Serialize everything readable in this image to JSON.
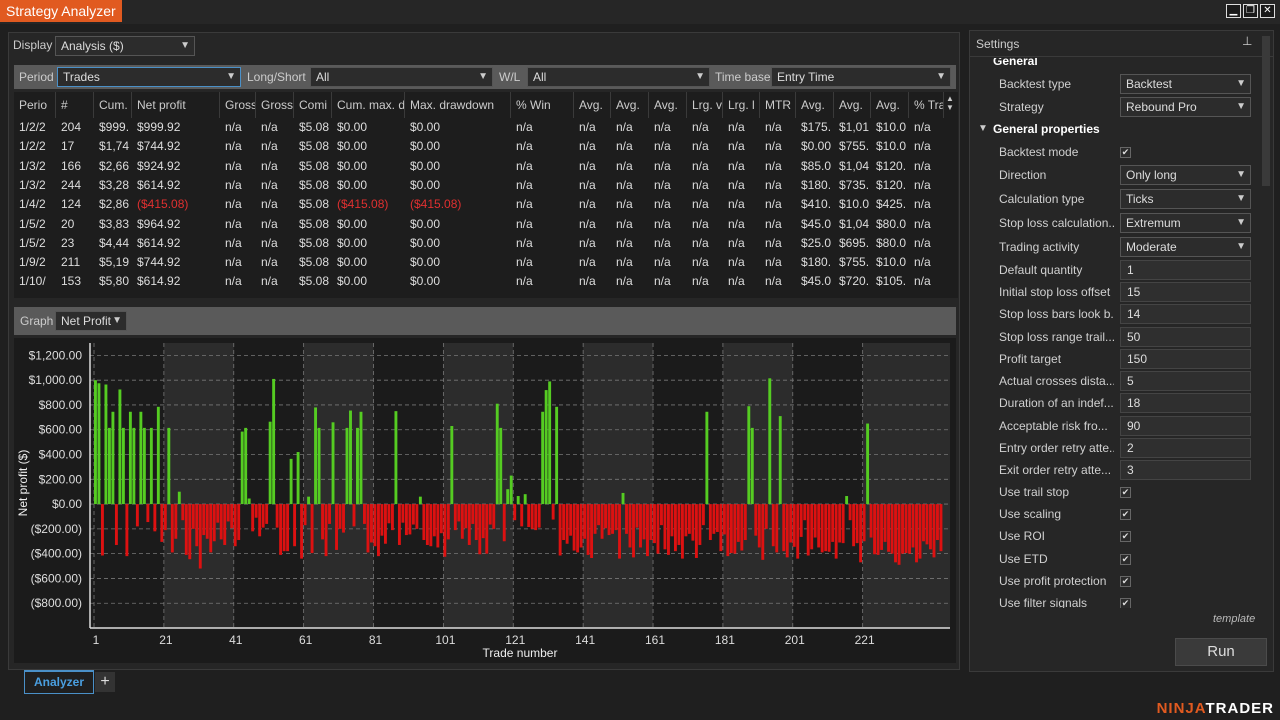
{
  "window": {
    "title": "Strategy Analyzer"
  },
  "display": {
    "label": "Display",
    "value": "Analysis ($)"
  },
  "filters": {
    "period_label": "Period",
    "period_value": "Trades",
    "longshort_label": "Long/Short",
    "longshort_value": "All",
    "wl_label": "W/L",
    "wl_value": "All",
    "timebase_label": "Time base",
    "timebase_value": "Entry Time"
  },
  "grid": {
    "columns": [
      "Perio",
      "#",
      "Cum.",
      "Net profit",
      "Gross",
      "Gross",
      "Comi",
      "Cum. max. d",
      "Max. drawdown",
      "% Win",
      "Avg.",
      "Avg.",
      "Avg.",
      "Lrg. v",
      "Lrg. l",
      "MTR",
      "Avg.",
      "Avg.",
      "Avg.",
      "% Tra"
    ],
    "rows": [
      [
        "1/2/2",
        "204",
        "$999.",
        "$999.92",
        "n/a",
        "n/a",
        "$5.08",
        "$0.00",
        "$0.00",
        "n/a",
        "n/a",
        "n/a",
        "n/a",
        "n/a",
        "n/a",
        "n/a",
        "$175.",
        "$1,01",
        "$10.0",
        "n/a"
      ],
      [
        "1/2/2",
        "17",
        "$1,74",
        "$744.92",
        "n/a",
        "n/a",
        "$5.08",
        "$0.00",
        "$0.00",
        "n/a",
        "n/a",
        "n/a",
        "n/a",
        "n/a",
        "n/a",
        "n/a",
        "$0.00",
        "$755.",
        "$10.0",
        "n/a"
      ],
      [
        "1/3/2",
        "166",
        "$2,66",
        "$924.92",
        "n/a",
        "n/a",
        "$5.08",
        "$0.00",
        "$0.00",
        "n/a",
        "n/a",
        "n/a",
        "n/a",
        "n/a",
        "n/a",
        "n/a",
        "$85.0",
        "$1,04",
        "$120.",
        "n/a"
      ],
      [
        "1/3/2",
        "244",
        "$3,28",
        "$614.92",
        "n/a",
        "n/a",
        "$5.08",
        "$0.00",
        "$0.00",
        "n/a",
        "n/a",
        "n/a",
        "n/a",
        "n/a",
        "n/a",
        "n/a",
        "$180.",
        "$735.",
        "$120.",
        "n/a"
      ],
      [
        "1/4/2",
        "124",
        "$2,86",
        "($415.08)",
        "n/a",
        "n/a",
        "$5.08",
        "($415.08)",
        "($415.08)",
        "n/a",
        "n/a",
        "n/a",
        "n/a",
        "n/a",
        "n/a",
        "n/a",
        "$410.",
        "$10.0",
        "$425.",
        "n/a"
      ],
      [
        "1/5/2",
        "20",
        "$3,83",
        "$964.92",
        "n/a",
        "n/a",
        "$5.08",
        "$0.00",
        "$0.00",
        "n/a",
        "n/a",
        "n/a",
        "n/a",
        "n/a",
        "n/a",
        "n/a",
        "$45.0",
        "$1,04",
        "$80.0",
        "n/a"
      ],
      [
        "1/5/2",
        "23",
        "$4,44",
        "$614.92",
        "n/a",
        "n/a",
        "$5.08",
        "$0.00",
        "$0.00",
        "n/a",
        "n/a",
        "n/a",
        "n/a",
        "n/a",
        "n/a",
        "n/a",
        "$25.0",
        "$695.",
        "$80.0",
        "n/a"
      ],
      [
        "1/9/2",
        "211",
        "$5,19",
        "$744.92",
        "n/a",
        "n/a",
        "$5.08",
        "$0.00",
        "$0.00",
        "n/a",
        "n/a",
        "n/a",
        "n/a",
        "n/a",
        "n/a",
        "n/a",
        "$180.",
        "$755.",
        "$10.0",
        "n/a"
      ],
      [
        "1/10/",
        "153",
        "$5,80",
        "$614.92",
        "n/a",
        "n/a",
        "$5.08",
        "$0.00",
        "$0.00",
        "n/a",
        "n/a",
        "n/a",
        "n/a",
        "n/a",
        "n/a",
        "n/a",
        "$45.0",
        "$720.",
        "$105.",
        "n/a"
      ]
    ]
  },
  "graph": {
    "label": "Graph",
    "value": "Net Profit"
  },
  "colors": {
    "accent": "#e15a20",
    "positive": "#55cc22",
    "negative": "#dd1111",
    "tab": "#4a9fe0"
  },
  "chart_data": {
    "type": "bar",
    "xlabel": "Trade number",
    "ylabel": "Net profit ($)",
    "ylim": [
      -1000,
      1300
    ],
    "yticks": [
      "$1,200.00",
      "$1,000.00",
      "$800.00",
      "$600.00",
      "$400.00",
      "$200.00",
      "$0.00",
      "($200.00)",
      "($400.00)",
      "($600.00)",
      "($800.00)"
    ],
    "ytick_values": [
      1200,
      1000,
      800,
      600,
      400,
      200,
      0,
      -200,
      -400,
      -600,
      -800
    ],
    "xticks": [
      "1",
      "21",
      "41",
      "61",
      "81",
      "101",
      "121",
      "141",
      "161",
      "181",
      "201",
      "221"
    ],
    "xtick_values": [
      1,
      21,
      41,
      61,
      81,
      101,
      121,
      141,
      161,
      181,
      201,
      221
    ],
    "x_count": 245,
    "values": [
      1000,
      975,
      -415,
      965,
      615,
      745,
      -330,
      925,
      615,
      -420,
      745,
      615,
      -180,
      745,
      615,
      -145,
      615,
      -220,
      785,
      -305,
      -210,
      615,
      -390,
      -280,
      100,
      -130,
      -410,
      -445,
      -200,
      -340,
      -520,
      -250,
      -280,
      -390,
      -300,
      -150,
      -285,
      -330,
      -140,
      -195,
      -340,
      -290,
      585,
      615,
      45,
      -220,
      -110,
      -260,
      -190,
      -160,
      665,
      1010,
      -190,
      -410,
      -380,
      -380,
      365,
      -340,
      420,
      -440,
      -170,
      60,
      -395,
      780,
      615,
      -285,
      -420,
      -160,
      660,
      -370,
      -200,
      -230,
      615,
      755,
      -180,
      615,
      745,
      -160,
      -390,
      -310,
      -340,
      -420,
      -255,
      -320,
      -155,
      -210,
      750,
      -330,
      -150,
      -250,
      -245,
      -165,
      -200,
      60,
      -290,
      -330,
      -340,
      -260,
      -350,
      -235,
      -425,
      -285,
      630,
      -210,
      -140,
      -280,
      -195,
      -330,
      -160,
      -290,
      -405,
      -275,
      -400,
      -165,
      -200,
      810,
      615,
      -300,
      120,
      230,
      -130,
      65,
      -180,
      80,
      -185,
      -200,
      -210,
      -190,
      745,
      920,
      990,
      -125,
      785,
      -415,
      -290,
      -320,
      -255,
      -375,
      -390,
      -350,
      -280,
      -410,
      -435,
      -240,
      -170,
      -280,
      -195,
      -250,
      -240,
      -210,
      -440,
      90,
      -240,
      -350,
      -430,
      -190,
      -350,
      -285,
      -420,
      -290,
      -315,
      -400,
      -170,
      -365,
      -410,
      -260,
      -380,
      -330,
      -440,
      -260,
      -240,
      -295,
      -435,
      -330,
      -170,
      745,
      -290,
      -240,
      -225,
      -380,
      -245,
      -420,
      -395,
      -400,
      -305,
      -375,
      -290,
      790,
      615,
      -255,
      -350,
      -450,
      -200,
      1015,
      -340,
      -390,
      710,
      -380,
      -430,
      -310,
      -345,
      -440,
      -265,
      -130,
      -415,
      -365,
      -270,
      -350,
      -390,
      -380,
      -385,
      -305,
      -440,
      -310,
      -315,
      65,
      -130,
      -340,
      -315,
      -470,
      -300,
      650,
      -270,
      -405,
      -410,
      -370,
      -305,
      -385,
      -400,
      -470,
      -490,
      -400,
      -395,
      -400,
      -350,
      -470,
      -440,
      -300,
      -325,
      -365,
      -430,
      -290,
      -380
    ]
  },
  "tabs": [
    {
      "label": "Analyzer"
    }
  ],
  "settings": {
    "title": "Settings",
    "section_general": "General",
    "backtest_type_label": "Backtest type",
    "backtest_type_value": "Backtest",
    "strategy_label": "Strategy",
    "strategy_value": "Rebound Pro",
    "section_general_properties": "General properties",
    "props": [
      {
        "label": "Backtest mode",
        "kind": "check",
        "value": "✔"
      },
      {
        "label": "Direction",
        "kind": "select",
        "value": "Only long"
      },
      {
        "label": "Calculation type",
        "kind": "select",
        "value": "Ticks"
      },
      {
        "label": "Stop loss calculation...",
        "kind": "select",
        "value": "Extremum"
      },
      {
        "label": "Trading activity",
        "kind": "select",
        "value": "Moderate"
      },
      {
        "label": "Default quantity",
        "kind": "text",
        "value": "1"
      },
      {
        "label": "Initial stop loss offset",
        "kind": "text",
        "value": "15"
      },
      {
        "label": "Stop loss bars look b...",
        "kind": "text",
        "value": "14"
      },
      {
        "label": "Stop loss range trail...",
        "kind": "text",
        "value": "50"
      },
      {
        "label": "Profit target",
        "kind": "text",
        "value": "150"
      },
      {
        "label": "Actual crosses dista...",
        "kind": "text",
        "value": "5"
      },
      {
        "label": "Duration of an indef...",
        "kind": "text",
        "value": "18"
      },
      {
        "label": "Acceptable risk fro...",
        "kind": "text",
        "value": "90"
      },
      {
        "label": "Entry order retry atte...",
        "kind": "text",
        "value": "2"
      },
      {
        "label": "Exit order retry atte...",
        "kind": "text",
        "value": "3"
      },
      {
        "label": "Use trail stop",
        "kind": "check",
        "value": "✔"
      },
      {
        "label": "Use scaling",
        "kind": "check",
        "value": "✔"
      },
      {
        "label": "Use ROI",
        "kind": "check",
        "value": "✔"
      },
      {
        "label": "Use ETD",
        "kind": "check",
        "value": "✔"
      },
      {
        "label": "Use profit protection",
        "kind": "check",
        "value": "✔"
      },
      {
        "label": "Use filter signals",
        "kind": "check",
        "value": "✔"
      }
    ],
    "template_link": "template",
    "run_label": "Run"
  },
  "logo": {
    "part1": "NINJA",
    "part2": "TRADER"
  }
}
